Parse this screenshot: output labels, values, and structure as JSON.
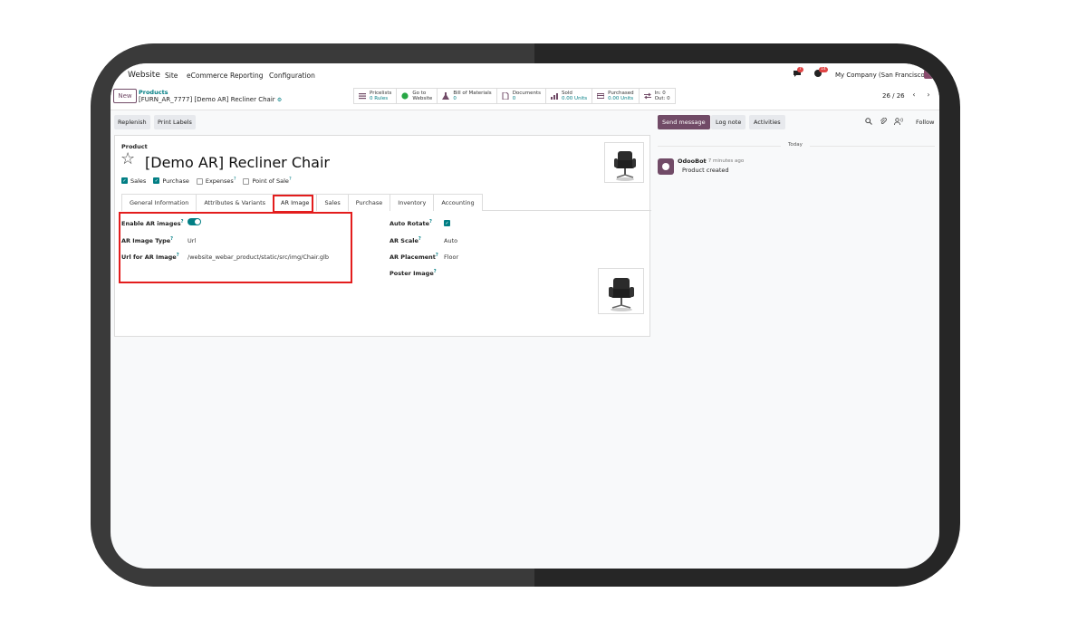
{
  "nav": {
    "app": "Website",
    "menu": [
      "Site",
      "eCommerce",
      "Reporting",
      "Configuration"
    ],
    "chat_badge": "7",
    "activity_badge": "14",
    "company": "My Company (San Francisco)"
  },
  "control_panel": {
    "new_label": "New",
    "breadcrumb_parent": "Products",
    "breadcrumb_current": "[FURN_AR_7777] [Demo AR] Recliner Chair",
    "smart_buttons": [
      {
        "line1": "Pricelists",
        "line2": "0 Rules"
      },
      {
        "line1": "Go to",
        "line2": "Website"
      },
      {
        "line1": "Bill of Materials",
        "line2": "0"
      },
      {
        "line1": "Documents",
        "line2": "0"
      },
      {
        "line1": "Sold",
        "line2": "0.00 Units"
      },
      {
        "line1": "Purchased",
        "line2": "0.00 Units"
      },
      {
        "line1": "In: 0",
        "line2": "Out: 0"
      }
    ],
    "pager": "26 / 26"
  },
  "actions": {
    "replenish": "Replenish",
    "print_labels": "Print Labels"
  },
  "form": {
    "product_label": "Product",
    "title": "[Demo AR] Recliner Chair",
    "checks": {
      "sales": "Sales",
      "purchase": "Purchase",
      "expenses": "Expenses",
      "pos": "Point of Sale"
    },
    "tabs": [
      "General Information",
      "Attributes & Variants",
      "AR Image",
      "Sales",
      "Purchase",
      "Inventory",
      "Accounting"
    ],
    "active_tab": "AR Image",
    "fields": {
      "enable_ar_label": "Enable AR images",
      "ar_type_label": "AR Image Type",
      "ar_type_value": "Url",
      "ar_url_label": "Url for AR Image",
      "ar_url_value": "/website_webar_product/static/src/img/Chair.glb",
      "auto_rotate_label": "Auto Rotate",
      "ar_scale_label": "AR Scale",
      "ar_scale_value": "Auto",
      "ar_placement_label": "AR Placement",
      "ar_placement_value": "Floor",
      "poster_label": "Poster Image"
    }
  },
  "chatter": {
    "send_message": "Send message",
    "log_note": "Log note",
    "activities": "Activities",
    "attachments_count": "0",
    "follow": "Follow",
    "today": "Today",
    "author": "OdooBot",
    "time": "- 7 minutes ago",
    "message": "Product created"
  }
}
